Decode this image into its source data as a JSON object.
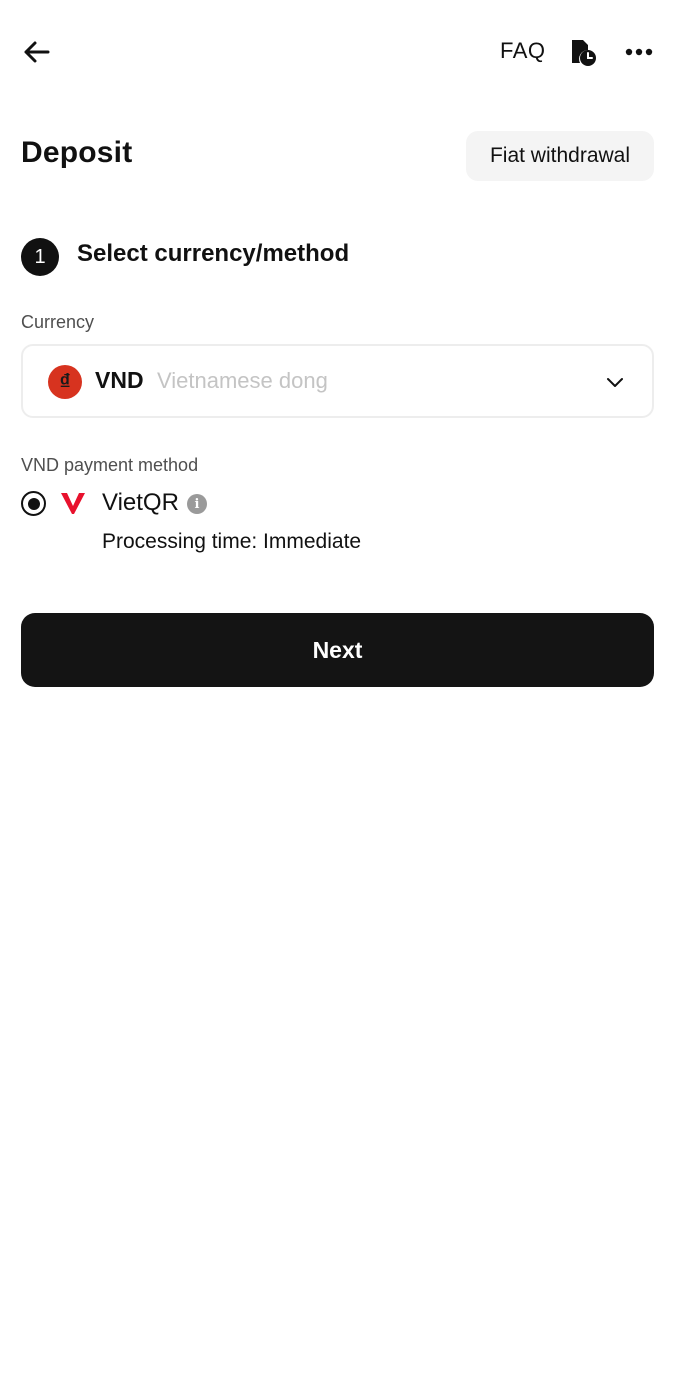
{
  "header": {
    "back_icon": "arrow-left-icon",
    "faq_label": "FAQ",
    "history_icon": "document-clock-icon",
    "more_icon": "ellipsis-icon"
  },
  "page": {
    "title": "Deposit",
    "fiat_withdrawal_label": "Fiat withdrawal"
  },
  "step": {
    "number": "1",
    "title": "Select currency/method"
  },
  "currency": {
    "label": "Currency",
    "icon_symbol": "₫",
    "code": "VND",
    "name": "Vietnamese dong",
    "icon_color": "#d7331f"
  },
  "payment": {
    "label": "VND payment method",
    "method_name": "VietQR",
    "selected": true,
    "info_symbol": "i",
    "processing_time": "Processing time: Immediate",
    "logo_color": "#e8112d"
  },
  "actions": {
    "next_label": "Next"
  },
  "colors": {
    "primary": "#141414",
    "muted_text": "#4f4f4f",
    "placeholder": "#c4c4c4"
  }
}
